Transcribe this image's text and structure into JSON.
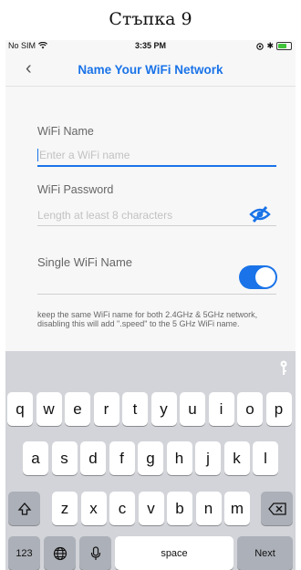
{
  "caption": "Стъпка 9",
  "status": {
    "carrier": "No SIM",
    "time": "3:35 PM"
  },
  "nav": {
    "back_glyph": "‹",
    "title": "Name Your WiFi Network"
  },
  "form": {
    "wifi_name_label": "WiFi Name",
    "wifi_name_placeholder": "Enter a WiFi name",
    "wifi_password_label": "WiFi Password",
    "wifi_password_placeholder": "Length at least 8 characters",
    "single_name_label": "Single WiFi Name",
    "single_name_enabled": true,
    "note": "keep the same WiFi name for both 2.4GHz & 5GHz network, disabling this will add \".speed\" to the 5 GHz WiFi name."
  },
  "keyboard": {
    "row1": [
      "q",
      "w",
      "e",
      "r",
      "t",
      "y",
      "u",
      "i",
      "o",
      "p"
    ],
    "row2": [
      "a",
      "s",
      "d",
      "f",
      "g",
      "h",
      "j",
      "k",
      "l"
    ],
    "row3": [
      "z",
      "x",
      "c",
      "v",
      "b",
      "n",
      "m"
    ],
    "numbers_label": "123",
    "space_label": "space",
    "next_label": "Next"
  },
  "colors": {
    "accent": "#1a73e8",
    "keyboard_bg": "#d2d4d9"
  }
}
